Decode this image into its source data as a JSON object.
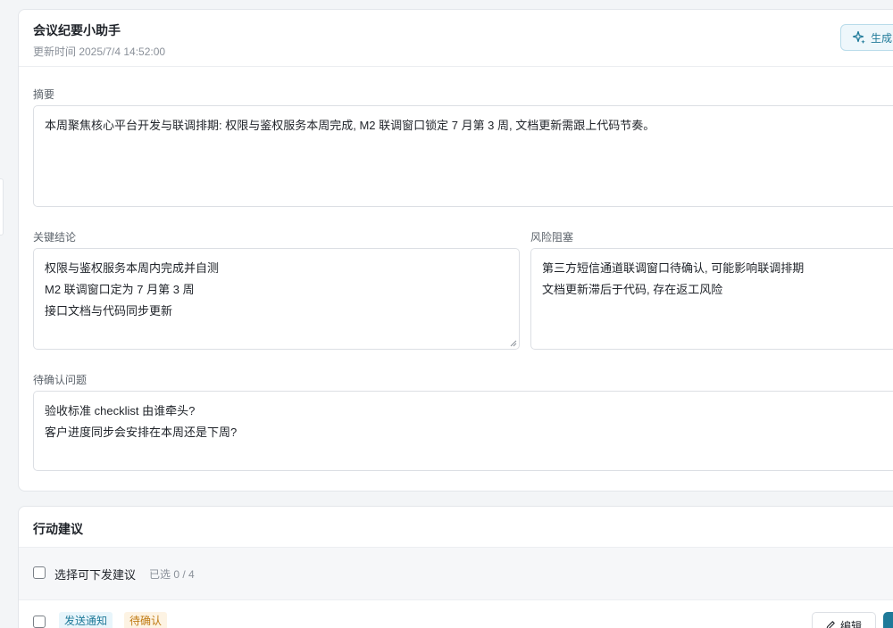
{
  "assistant": {
    "title": "会议纪要小助手",
    "updated": "更新时间 2025/7/4 14:52:00",
    "generate_label": "生成"
  },
  "summary": {
    "label": "摘要",
    "text": "本周聚焦核心平台开发与联调排期: 权限与鉴权服务本周完成, M2 联调窗口锁定 7 月第 3 周, 文档更新需跟上代码节奏。"
  },
  "conclusions": {
    "label": "关键结论",
    "lines": [
      "权限与鉴权服务本周内完成并自测",
      "M2 联调窗口定为 7 月第 3 周",
      "接口文档与代码同步更新"
    ]
  },
  "risks": {
    "label": "风险阻塞",
    "lines": [
      "第三方短信通道联调窗口待确认, 可能影响联调排期",
      "文档更新滞后于代码, 存在返工风险"
    ]
  },
  "questions": {
    "label": "待确认问题",
    "lines": [
      "验收标准 checklist 由谁牵头?",
      "客户进度同步会安排在本周还是下周?"
    ]
  },
  "actions": {
    "title": "行动建议",
    "select_label": "选择可下发建议",
    "selected_count": "已选 0 / 4",
    "first_item": {
      "type_tag": "发送通知",
      "status_tag": "待确认",
      "edit_label": "编辑"
    }
  }
}
